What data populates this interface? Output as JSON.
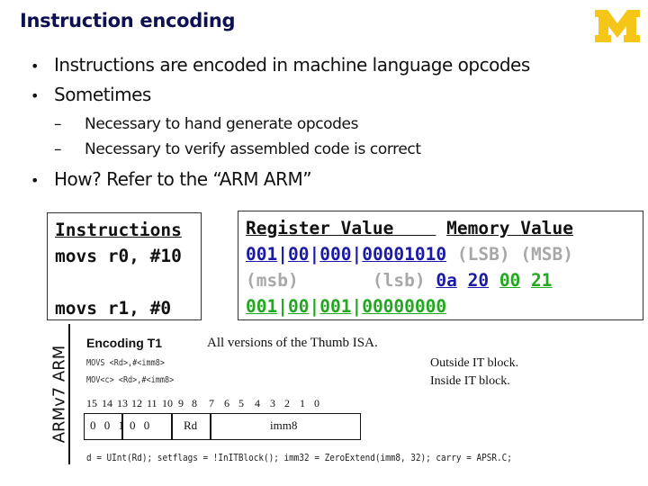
{
  "slide": {
    "title": "Instruction encoding",
    "logo_icon": "university-of-michigan-block-m-icon",
    "brand_color": "#f5c518"
  },
  "bullets": [
    {
      "level": 1,
      "text": "Instructions are encoded in machine language opcodes"
    },
    {
      "level": 1,
      "text": "Sometimes"
    },
    {
      "level": 2,
      "text": "Necessary to hand generate opcodes"
    },
    {
      "level": 2,
      "text": "Necessary to verify assembled code is correct"
    },
    {
      "level": 1,
      "text": "How? Refer to the “ARM ARM”"
    }
  ],
  "instructions_box": {
    "heading": "Instructions",
    "lines": [
      "movs r0, #10",
      "movs r1, #0"
    ]
  },
  "encoding_box": {
    "register_heading": "Register Value",
    "memory_heading": "Memory Value",
    "reg_line1": [
      "001",
      "00",
      "000",
      "00001010"
    ],
    "msb_label": "(msb)",
    "lsb_label": "(lsb)",
    "reg_line2": [
      "001",
      "00",
      "001",
      "00000000"
    ],
    "mem_order_label": "(LSB) (MSB)",
    "mem_bytes": [
      {
        "value": "0a",
        "color": "blue"
      },
      {
        "value": "20",
        "color": "blue"
      },
      {
        "value": "00",
        "color": "green"
      },
      {
        "value": "21",
        "color": "green"
      }
    ],
    "colors": {
      "blue": "#1a1aa6",
      "green": "#22a81e",
      "gray": "#a8a8a8"
    }
  },
  "arm_ref": {
    "side_label": "ARMv7 ARM",
    "encoding_title": "Encoding T1",
    "applies_to": "All versions of the Thumb ISA.",
    "syntax": [
      {
        "text": "MOVS <Rd>,#<imm8>",
        "note": "Outside IT block."
      },
      {
        "text": "MOV<c> <Rd>,#<imm8>",
        "note": "Inside IT block."
      }
    ],
    "bit_numbers": [
      "15",
      "14",
      "13",
      "12",
      "11",
      "10",
      "9",
      "8",
      "7",
      "6",
      "5",
      "4",
      "3",
      "2",
      "1",
      "0"
    ],
    "fields": [
      "0",
      "0",
      "1",
      "0",
      "0",
      "Rd",
      "imm8"
    ],
    "pseudocode": "d = UInt(Rd);  setflags = !InITBlock();  imm32 = ZeroExtend(imm8, 32);  carry = APSR.C;"
  }
}
